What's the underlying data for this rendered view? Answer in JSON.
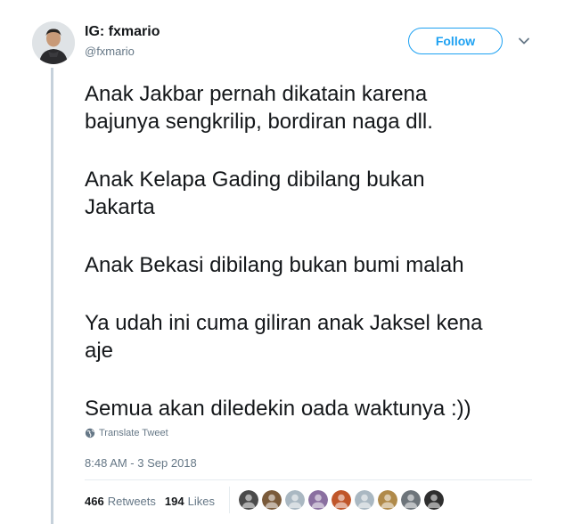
{
  "tweet": {
    "display_name": "IG: fxmario",
    "handle": "@fxmario",
    "follow_label": "Follow",
    "paragraphs": [
      [
        "Anak Jakbar pernah dikatain karena",
        "bajunya sengkrilip, bordiran naga dll."
      ],
      [
        "Anak Kelapa Gading dibilang bukan",
        "Jakarta"
      ],
      [
        "Anak Bekasi dibilang bukan bumi malah"
      ],
      [
        "Ya udah ini cuma giliran anak Jaksel kena",
        "aje"
      ],
      [
        "Semua akan diledekin oada waktunya :))"
      ]
    ],
    "translate_label": "Translate Tweet",
    "timestamp": "8:48 AM - 3 Sep 2018",
    "retweets_count": "466",
    "retweets_label": "Retweets",
    "likes_count": "194",
    "likes_label": "Likes"
  },
  "likers": [
    {
      "icon": "avatar-dark",
      "color": "#4a4a4a"
    },
    {
      "icon": "avatar-face",
      "color": "#7a5a3a"
    },
    {
      "icon": "avatar-default",
      "color": "#aab8c2"
    },
    {
      "icon": "avatar-colorful",
      "color": "#8a6fa0"
    },
    {
      "icon": "avatar-warm",
      "color": "#c0562a"
    },
    {
      "icon": "avatar-default",
      "color": "#aab8c2"
    },
    {
      "icon": "avatar-illustration",
      "color": "#b08a4a"
    },
    {
      "icon": "avatar-gray",
      "color": "#6d747a"
    },
    {
      "icon": "avatar-black",
      "color": "#2e2e2e"
    }
  ],
  "colors": {
    "accent": "#1da1f2",
    "secondary_text": "#657786",
    "thread_line": "#c6d1db"
  }
}
